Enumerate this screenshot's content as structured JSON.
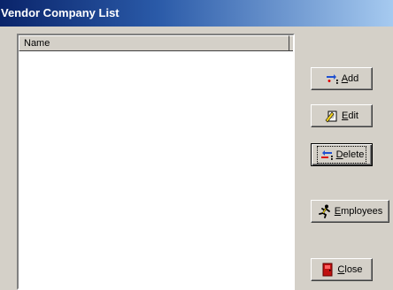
{
  "window": {
    "title": "Vendor Company List"
  },
  "list": {
    "column_header": "Name"
  },
  "buttons": {
    "add": {
      "mnemonic": "A",
      "rest": "dd"
    },
    "edit": {
      "mnemonic": "E",
      "rest": "dit"
    },
    "delete": {
      "mnemonic": "D",
      "rest": "elete"
    },
    "employees": {
      "mnemonic": "E",
      "rest": "mployees"
    },
    "close": {
      "mnemonic": "C",
      "rest": "lose"
    }
  },
  "icons": {
    "add": "add-record-icon",
    "edit": "edit-document-icon",
    "delete": "delete-record-icon",
    "employees": "running-person-icon",
    "close": "exit-door-icon"
  }
}
